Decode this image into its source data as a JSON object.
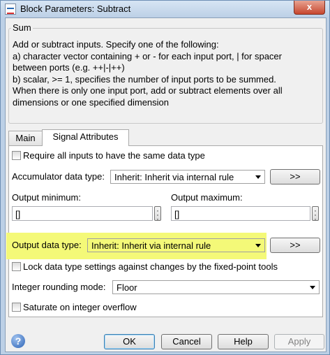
{
  "window": {
    "title": "Block Parameters: Subtract",
    "close_label": "x"
  },
  "group": {
    "label": "Sum",
    "description_lines": [
      "Add or subtract inputs.  Specify one of the following:",
      "a) character vector containing + or - for each input port, | for spacer",
      "between ports (e.g. ++|-|++)",
      "b) scalar, >= 1, specifies the number of input ports to be summed.",
      "When there is only one input port, add or subtract elements over all",
      "dimensions or one specified dimension"
    ]
  },
  "tabs": [
    {
      "label": "Main",
      "active": false
    },
    {
      "label": "Signal Attributes",
      "active": true
    }
  ],
  "signal_attributes": {
    "require_same_type_label": "Require all inputs to have the same data type",
    "require_same_type_checked": false,
    "accumulator_label": "Accumulator data type:",
    "accumulator_value": "Inherit: Inherit via internal rule",
    "assistant_button": ">>",
    "output_min_label": "Output minimum:",
    "output_min_value": "[]",
    "output_max_label": "Output maximum:",
    "output_max_value": "[]",
    "output_type_label": "Output data type:",
    "output_type_value": "Inherit: Inherit via internal rule",
    "lock_label": "Lock data type settings against changes by the fixed-point tools",
    "lock_checked": false,
    "rounding_label": "Integer rounding mode:",
    "rounding_value": "Floor",
    "saturate_label": "Saturate on integer overflow",
    "saturate_checked": false
  },
  "footer": {
    "help_icon": "?",
    "ok": "OK",
    "cancel": "Cancel",
    "help": "Help",
    "apply": "Apply"
  },
  "colors": {
    "highlight": "#f4f978",
    "window_frame": "#bcd0e6",
    "close_button": "#c7472f"
  }
}
